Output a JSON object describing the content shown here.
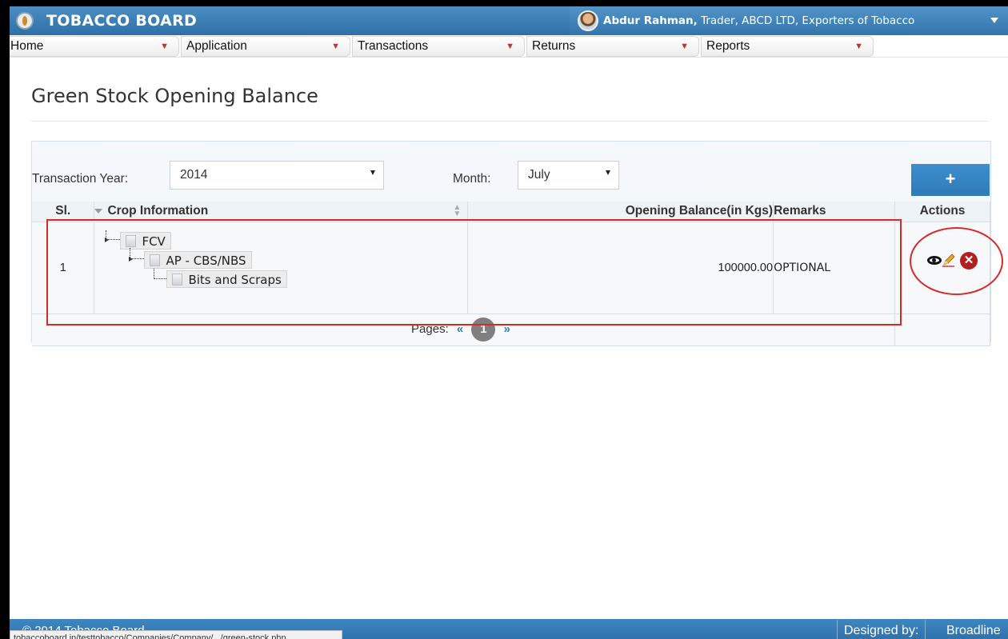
{
  "header": {
    "brand": "TOBACCO BOARD",
    "user_name": "Abdur Rahman,",
    "user_details": " Trader, ABCD LTD, Exporters of Tobacco"
  },
  "nav": {
    "items": [
      {
        "label": "Home"
      },
      {
        "label": "Application"
      },
      {
        "label": "Transactions"
      },
      {
        "label": "Returns"
      },
      {
        "label": "Reports"
      }
    ]
  },
  "page": {
    "title": "Green Stock Opening Balance"
  },
  "filters": {
    "year_label": "Transaction Year:",
    "year_value": "2014",
    "month_label": "Month:",
    "month_value": "July",
    "add_button": "+"
  },
  "table": {
    "headers": {
      "sl": "Sl.",
      "crop": "Crop Information",
      "opening": "Opening Balance(in Kgs)",
      "remarks": "Remarks",
      "actions": "Actions"
    },
    "rows": [
      {
        "sl": "1",
        "crop_tree": [
          "FCV",
          "AP - CBS/NBS",
          "Bits and Scraps"
        ],
        "opening": "100000.00",
        "remarks": "OPTIONAL"
      }
    ]
  },
  "pager": {
    "label": "Pages:",
    "prev": "«",
    "current": "1",
    "next": "»"
  },
  "footer": {
    "copyright": "© 2014 Tobacco Board",
    "designed_by": "Designed by:",
    "designer": "Broadline",
    "status_url": "tobaccoboard.in/testtobacco/Companies/Company/.../green-stock.php"
  }
}
